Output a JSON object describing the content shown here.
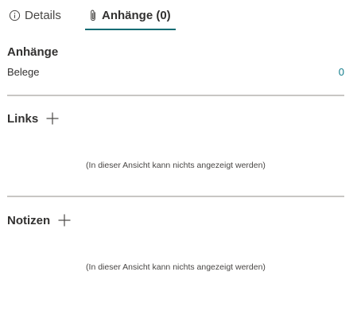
{
  "tabs": [
    {
      "label": "Details",
      "icon": "info-icon",
      "active": false
    },
    {
      "label": "Anhänge (0)",
      "icon": "paperclip-icon",
      "active": true
    }
  ],
  "attachments": {
    "title": "Anhänge",
    "receipts_label": "Belege",
    "receipts_count": "0"
  },
  "links": {
    "title": "Links",
    "empty_message": "(In dieser Ansicht kann nichts angezeigt werden)"
  },
  "notes": {
    "title": "Notizen",
    "empty_message": "(In dieser Ansicht kann nichts angezeigt werden)"
  },
  "colors": {
    "accent": "#0f6c74",
    "link": "#0f7b8a",
    "divider": "#c8c6c4",
    "text": "#323130"
  }
}
